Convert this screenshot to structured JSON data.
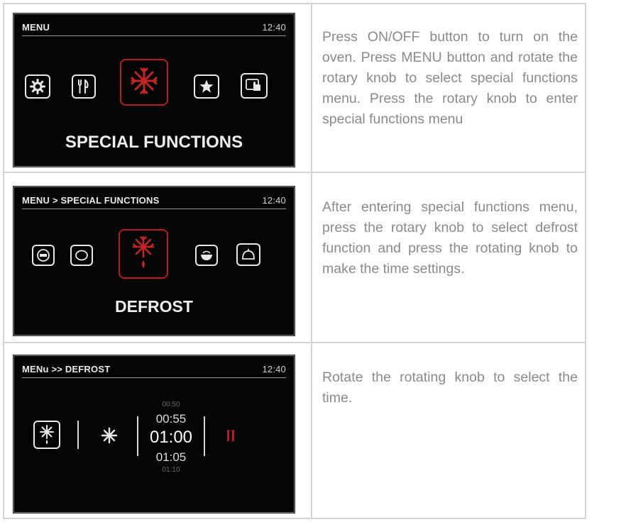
{
  "rows": [
    {
      "screen": {
        "breadcrumb": "MENU",
        "time": "12:40",
        "label": "SPECIAL FUNCTIONS",
        "icons": [
          "gear-icon",
          "cutlery-icon",
          "snowflake-icon",
          "star-icon",
          "hand-touch-icon"
        ],
        "selected_icon": "snowflake-icon"
      },
      "description": "Press ON/OFF button to turn on the oven. Press MENU button and rotate the rotary knob to select special functions menu. Press the rotary knob to enter special functions menu"
    },
    {
      "screen": {
        "breadcrumb": "MENU > SPECIAL FUNCTIONS",
        "time": "12:40",
        "label": "DEFROST",
        "icons": [
          "timer-icon",
          "bread-icon",
          "snowflake-drop-icon",
          "bowl-icon",
          "dome-icon"
        ],
        "selected_icon": "snowflake-drop-icon"
      },
      "description": "After entering special functions menu, press the rotary knob to select defrost function and press the rotating knob to make the time settings."
    },
    {
      "screen": {
        "breadcrumb": "MENu >> DEFROST",
        "time": "12:40",
        "times": [
          "00:50",
          "00:55",
          "01:00",
          "01:05",
          "01:10"
        ],
        "selected_time": "01:00",
        "icons": [
          "snowflake-drop-icon",
          "fan-star-icon",
          "pause-icon"
        ]
      },
      "description": "Rotate the rotating knob to select the time."
    }
  ],
  "colors": {
    "screen_bg": "#050505",
    "accent_red": "#b81d1d",
    "text_grey": "#8a8a8a",
    "border": "#d4d4d4"
  }
}
